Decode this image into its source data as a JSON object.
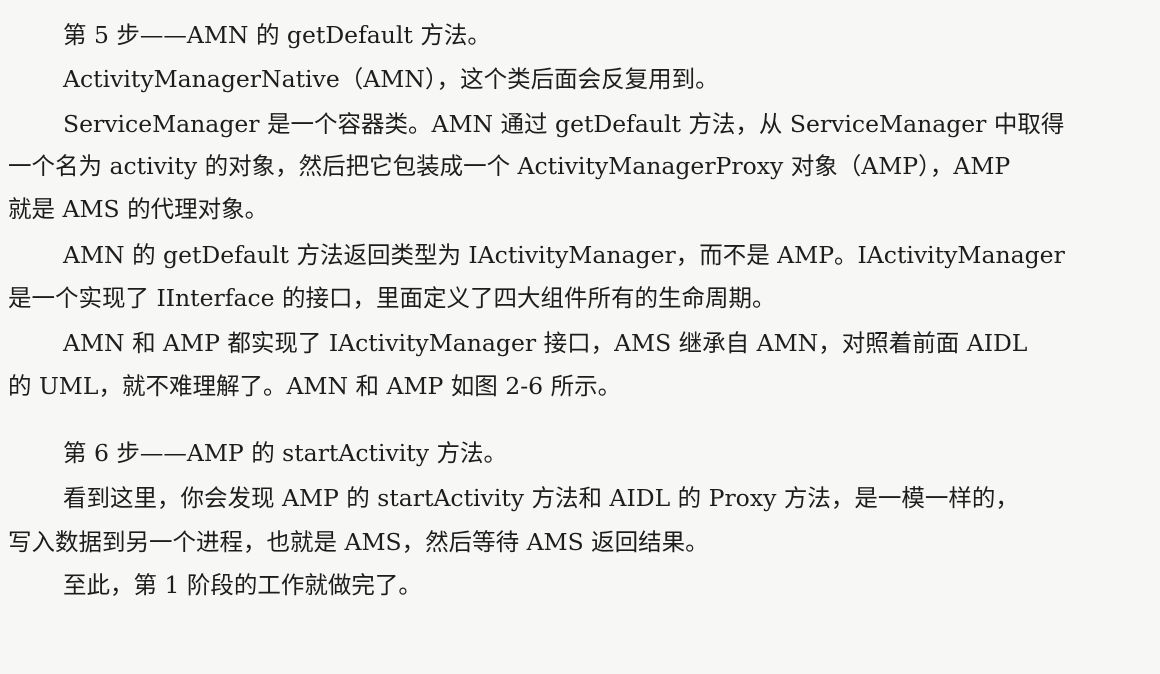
{
  "paragraphs": [
    {
      "lines": [
        "第 5 步——AMN 的 getDefault 方法。"
      ]
    },
    {
      "lines": [
        "ActivityManagerNative（AMN），这个类后面会反复用到。"
      ]
    },
    {
      "lines": [
        "ServiceManager 是一个容器类",
        "。AMN 通过 getDefault 方法，从 ServiceManager 中取得",
        "一个名为 activity 的对象，然后把它包装成一个 ActivityManagerProxy 对象（AMP），AMP",
        "就是 AMS 的代理对象。"
      ]
    },
    {
      "lines": [
        "AMN 的 getDefault 方法返回类型为 IActivityManager，而不是 AMP。IActivityManager",
        "是一个实现了 IInterface 的接口，里面定义了四大组件所有的生命周期。"
      ]
    },
    {
      "lines": [
        "AMN 和 AMP 都实现了 IActivityManager 接口，AMS 继承自 AMN，对照着前面 AIDL",
        "的 UML，就不难理解了。AMN 和 AMP 如图 2-6 所示。"
      ]
    },
    {
      "lines": [
        "第 6 步——AMP 的 startActivity 方法。"
      ]
    },
    {
      "lines": [
        "看到这里，你会发现 AMP 的 startActivity 方法和 AIDL 的 Proxy 方法，是一模一样的，",
        "写入数据到另一个进程，也就是 AMS，然后等待 AMS 返回结果。"
      ]
    },
    {
      "lines": [
        "至此，第 1 阶段的工作就做完了。"
      ]
    }
  ],
  "underline_color": "#d9262a"
}
